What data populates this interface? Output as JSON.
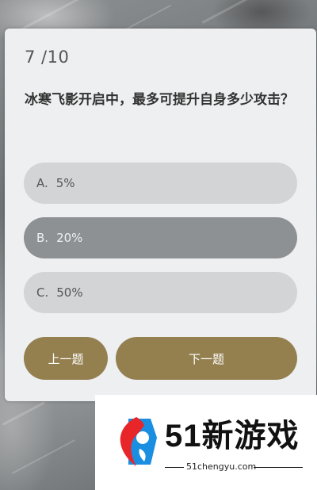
{
  "quiz": {
    "progress": "7 /10",
    "question": "冰寒飞影开启中，最多可提升自身多少攻击？",
    "options": [
      {
        "key": "A.",
        "text": "5%"
      },
      {
        "key": "B.",
        "text": "20%"
      },
      {
        "key": "C.",
        "text": "50%"
      }
    ],
    "selected_option": "B.",
    "prev_label": "上一题",
    "next_label": "下一题"
  },
  "watermark": {
    "brand": "51新游戏",
    "domain": "51chengyu.com"
  },
  "colors": {
    "card_bg": "#eeeff0",
    "option_bg": "#d3d4d5",
    "option_selected_bg": "#8e9194",
    "button_gold": "#94804f",
    "logo_red": "#e8262a",
    "logo_blue": "#1a8ee0"
  }
}
